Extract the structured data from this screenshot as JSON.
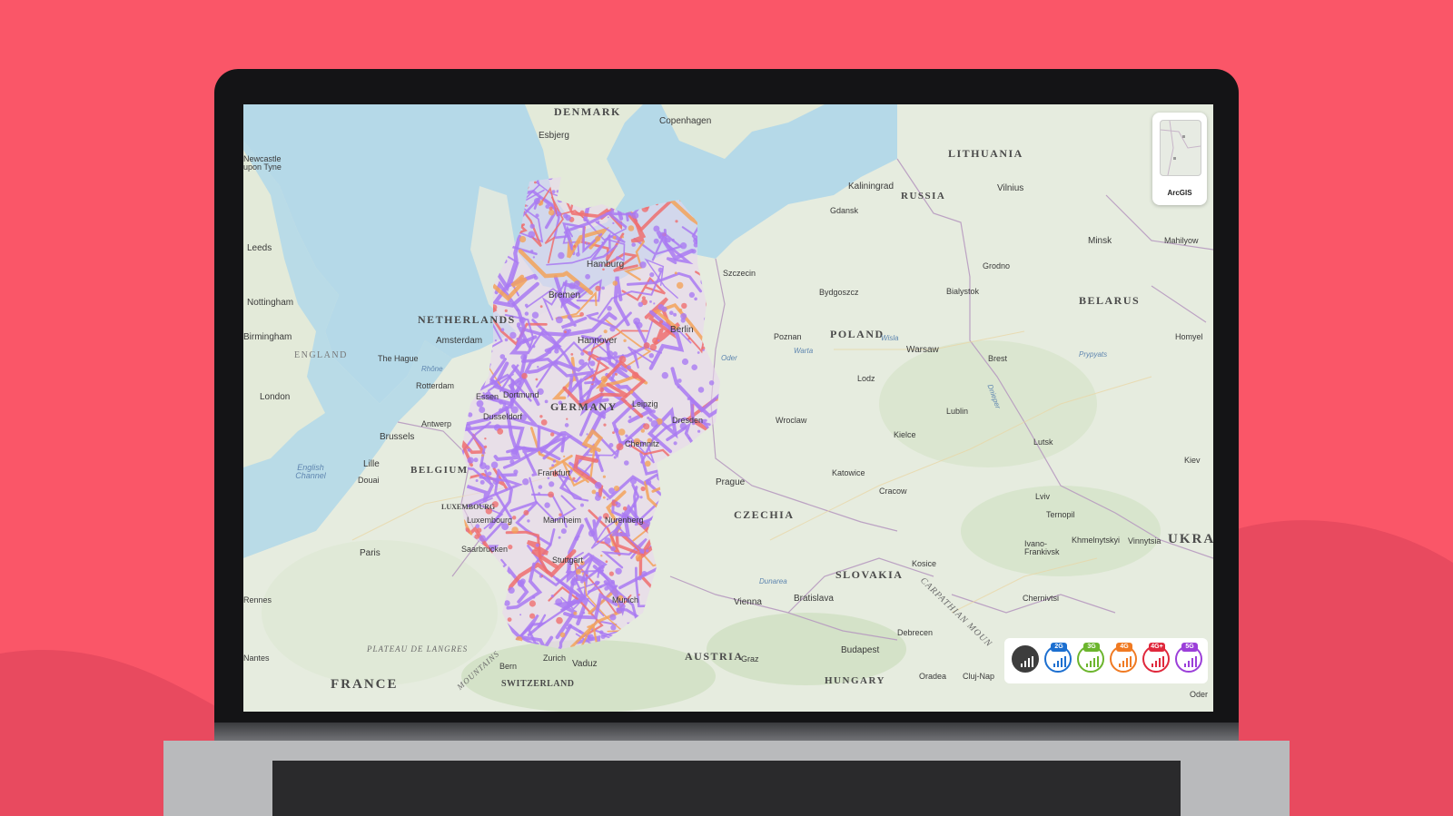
{
  "page": {
    "background_color": "#fa5668",
    "wave_color": "#e84a5f"
  },
  "map": {
    "country_labels": [
      "DENMARK",
      "LITHUANIA",
      "RUSSIA",
      "BELARUS",
      "NETHERLANDS",
      "POLAND",
      "GERMANY",
      "BELGIUM",
      "ENGLAND",
      "LUXEMBOURG",
      "CZECHIA",
      "SLOVAKIA",
      "AUSTRIA",
      "HUNGARY",
      "FRANCE",
      "SWITZERLAND",
      "UKRA"
    ],
    "city_labels": [
      "Copenhagen",
      "Esbjerg",
      "Newcastle upon Tyne",
      "Kaliningrad",
      "Gdansk",
      "Vilnius",
      "Minsk",
      "Mahilyow",
      "Grodno",
      "Leeds",
      "Szczecin",
      "Bydgoszcz",
      "Bialystok",
      "Nottingham",
      "Hamburg",
      "Bremen",
      "Poznan",
      "Warsaw",
      "Homyel",
      "Amsterdam",
      "Berlin",
      "Hannover",
      "Birmingham",
      "The Hague",
      "Brest",
      "London",
      "Rotterdam",
      "Lodz",
      "Leipzig",
      "Essen",
      "Dortmund",
      "Dusseldorf",
      "Antwerp",
      "Dresden",
      "Lublin",
      "Wroclaw",
      "Brussels",
      "Kielce",
      "Lutsk",
      "Lille",
      "Chemnitz",
      "Douai",
      "Katowice",
      "Kiev",
      "Frankfurt",
      "Prague",
      "Cracow",
      "Lviv",
      "Luxembourg",
      "Ternopil",
      "Mannheim",
      "Nurenberg",
      "Khmelnytskyi",
      "Vinnytsia",
      "Saarbrucken",
      "Ivano-Frankivsk",
      "Paris",
      "Stuttgart",
      "Kosice",
      "Chernivtsi",
      "Rennes",
      "Vienna",
      "Bratislava",
      "Munich",
      "Debrecen",
      "Nantes",
      "Budapest",
      "Zurich",
      "Vaduz",
      "Graz",
      "Oradea",
      "Cluj-Nap",
      "Bern",
      "Oder"
    ],
    "geo_labels": [
      "PLATEAU DE LANGRES",
      "CARPATHIAN MOUN",
      "MOUNTAINS"
    ],
    "water_labels": [
      "English Channel",
      "Rhône",
      "Warta",
      "Wisla",
      "Oder",
      "Dnieper",
      "Prypyats",
      "Dunarea"
    ]
  },
  "basemap_switcher": {
    "label": "ArcGIS",
    "icon": "basemap-thumbnail"
  },
  "legend": {
    "items": [
      {
        "name": "all-networks",
        "label": "",
        "color": "#3d3d3d"
      },
      {
        "name": "2g",
        "label": "2G",
        "color": "#1c6fd0"
      },
      {
        "name": "3g",
        "label": "3G",
        "color": "#6cb52d"
      },
      {
        "name": "4g",
        "label": "4G",
        "color": "#f07a22"
      },
      {
        "name": "4g-plus",
        "label": "4G+",
        "color": "#e0283c"
      },
      {
        "name": "5g",
        "label": "5G",
        "color": "#9b3fd9"
      }
    ]
  },
  "coverage_colors": {
    "5g": "#a97af2",
    "4g-plus": "#ef6f6f",
    "4g": "#f3a35a"
  }
}
